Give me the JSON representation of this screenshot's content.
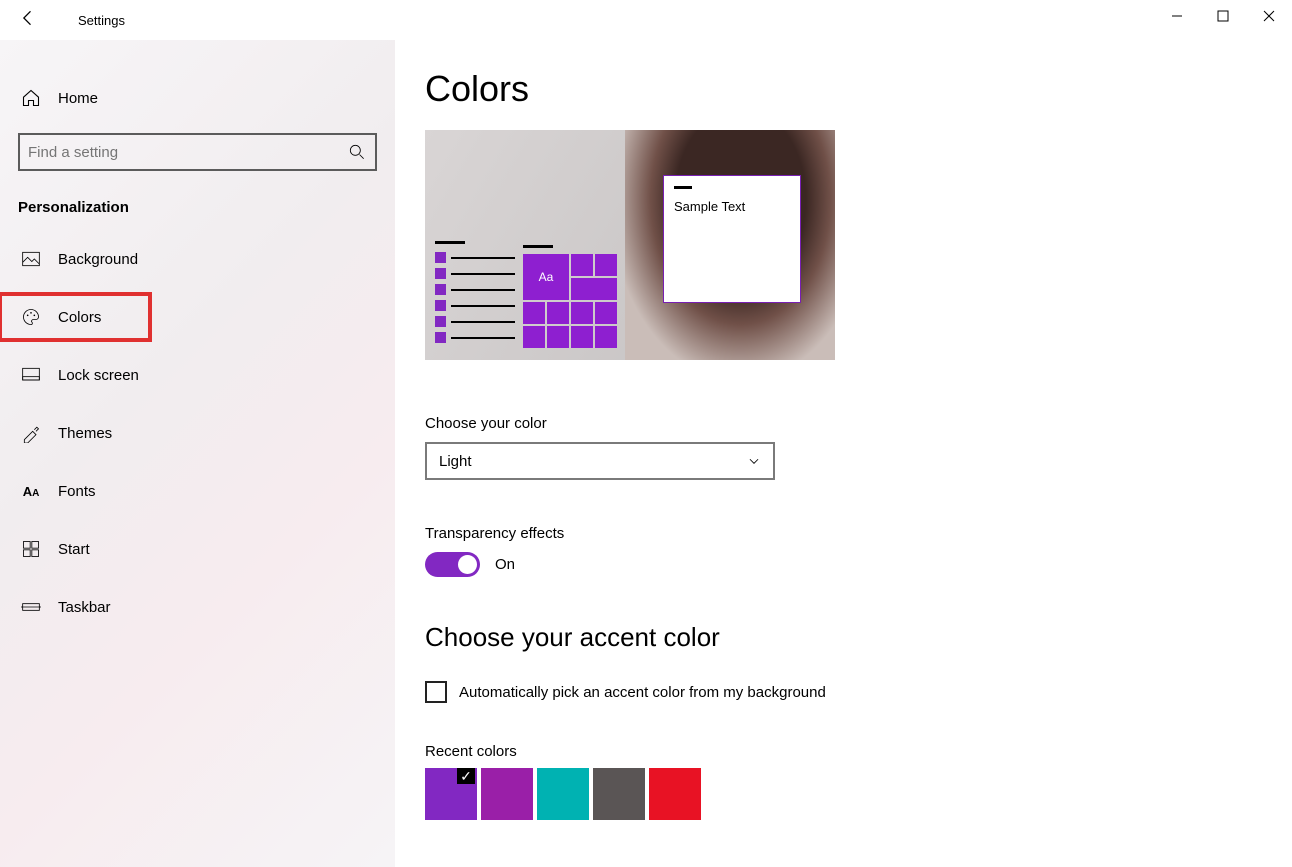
{
  "window": {
    "title": "Settings"
  },
  "sidebar": {
    "home": "Home",
    "search_placeholder": "Find a setting",
    "section": "Personalization",
    "items": [
      {
        "id": "background",
        "label": "Background"
      },
      {
        "id": "colors",
        "label": "Colors",
        "highlighted": true
      },
      {
        "id": "lock-screen",
        "label": "Lock screen"
      },
      {
        "id": "themes",
        "label": "Themes"
      },
      {
        "id": "fonts",
        "label": "Fonts"
      },
      {
        "id": "start",
        "label": "Start"
      },
      {
        "id": "taskbar",
        "label": "Taskbar"
      }
    ]
  },
  "main": {
    "heading": "Colors",
    "preview_sample_text": "Sample Text",
    "preview_tile_label": "Aa",
    "choose_color_label": "Choose your color",
    "choose_color_value": "Light",
    "transparency_label": "Transparency effects",
    "transparency_state": "On",
    "accent_heading": "Choose your accent color",
    "auto_pick_label": "Automatically pick an accent color from my background",
    "auto_pick_checked": false,
    "recent_label": "Recent colors",
    "recent_colors": [
      {
        "hex": "#8228c2",
        "selected": true
      },
      {
        "hex": "#9a1fa8",
        "selected": false
      },
      {
        "hex": "#00b2b2",
        "selected": false
      },
      {
        "hex": "#5a5555",
        "selected": false
      },
      {
        "hex": "#e81224",
        "selected": false
      }
    ]
  }
}
